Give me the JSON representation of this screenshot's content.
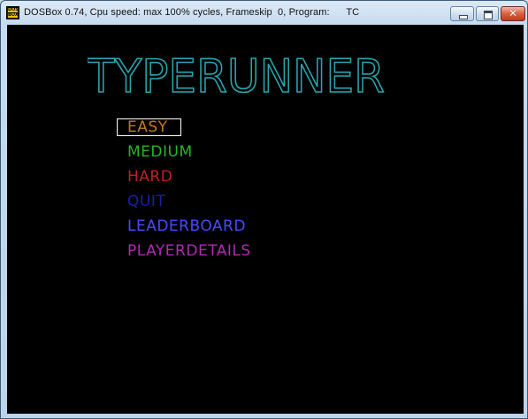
{
  "window": {
    "title": "DOSBox 0.74, Cpu speed: max 100% cycles, Frameskip  0, Program:      TC",
    "icon_text_top": "DOS",
    "icon_text_bottom": "BOX",
    "buttons": [
      "minimize",
      "maximize",
      "close"
    ]
  },
  "game": {
    "title": "TYPERUNNER",
    "title_color": "#2aa6b0",
    "menu": [
      {
        "label": "EASY",
        "color": "#c8781a",
        "selected": true
      },
      {
        "label": "MEDIUM",
        "color": "#28b428"
      },
      {
        "label": "HARD",
        "color": "#c81e1e"
      },
      {
        "label": "QUIT",
        "color": "#1e1eaa"
      },
      {
        "label": "LEADERBOARD",
        "color": "#4a4aff"
      },
      {
        "label": "PLAYERDETAILS",
        "color": "#b428b4"
      }
    ]
  }
}
